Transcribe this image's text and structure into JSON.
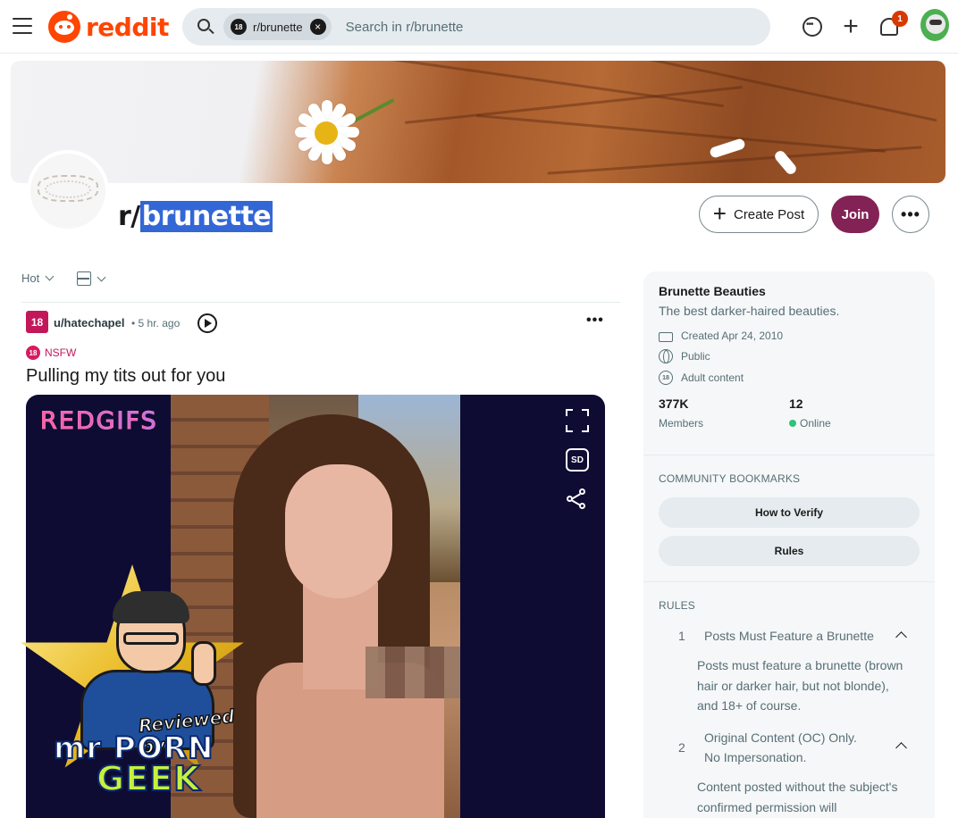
{
  "header": {
    "logo_text": "reddit",
    "search": {
      "chip_label": "r/brunette",
      "chip_avatar": "18",
      "placeholder": "Search in r/brunette"
    },
    "notification_count": "1",
    "icons": [
      "menu-icon",
      "search-icon",
      "chat-icon",
      "plus-icon",
      "bell-icon"
    ]
  },
  "subreddit": {
    "prefix": "r/",
    "name": "brunette",
    "create_post_label": "Create Post",
    "join_label": "Join",
    "more_label": "•••",
    "join_color": "#832255"
  },
  "feed": {
    "sort_label": "Hot",
    "post": {
      "avatar_label": "18",
      "author": "u/hatechapel",
      "time": "• 5 hr. ago",
      "more_label": "•••",
      "nsfw_label": "NSFW",
      "nsfw_badge": "18",
      "title": "Pulling my tits out for you",
      "media": {
        "brand": "REDGIFS",
        "quality_label": "SD"
      }
    }
  },
  "watermark": {
    "line1": "Reviewed by",
    "line2": "mr PORN",
    "line3": "GEEK"
  },
  "sidebar": {
    "title": "Brunette Beauties",
    "description": "The best darker-haired beauties.",
    "meta": [
      {
        "icon": "cake-icon",
        "text": "Created Apr 24, 2010"
      },
      {
        "icon": "globe-icon",
        "text": "Public"
      },
      {
        "icon": "adult-content-icon",
        "text": "Adult content"
      }
    ],
    "adult_icon_label": "18",
    "stats": {
      "members_value": "377K",
      "members_label": "Members",
      "online_value": "12",
      "online_label": "Online"
    },
    "bookmarks": {
      "heading": "COMMUNITY BOOKMARKS",
      "items": [
        "How to Verify",
        "Rules"
      ]
    },
    "rules": {
      "heading": "RULES",
      "items": [
        {
          "number": "1",
          "title": "Posts Must Feature a Brunette",
          "body": "Posts must feature a brunette (brown hair or darker hair, but not blonde), and 18+ of course."
        },
        {
          "number": "2",
          "title_line1": "Original Content (OC) Only.",
          "title_line2": "No Impersonation.",
          "body": "Content posted without the subject's confirmed permission will"
        }
      ]
    }
  },
  "colors": {
    "reddit_orange": "#ff4500",
    "nsfw_pink": "#d81b60",
    "online_green": "#2ec27e",
    "selection_blue": "#3367d6"
  }
}
